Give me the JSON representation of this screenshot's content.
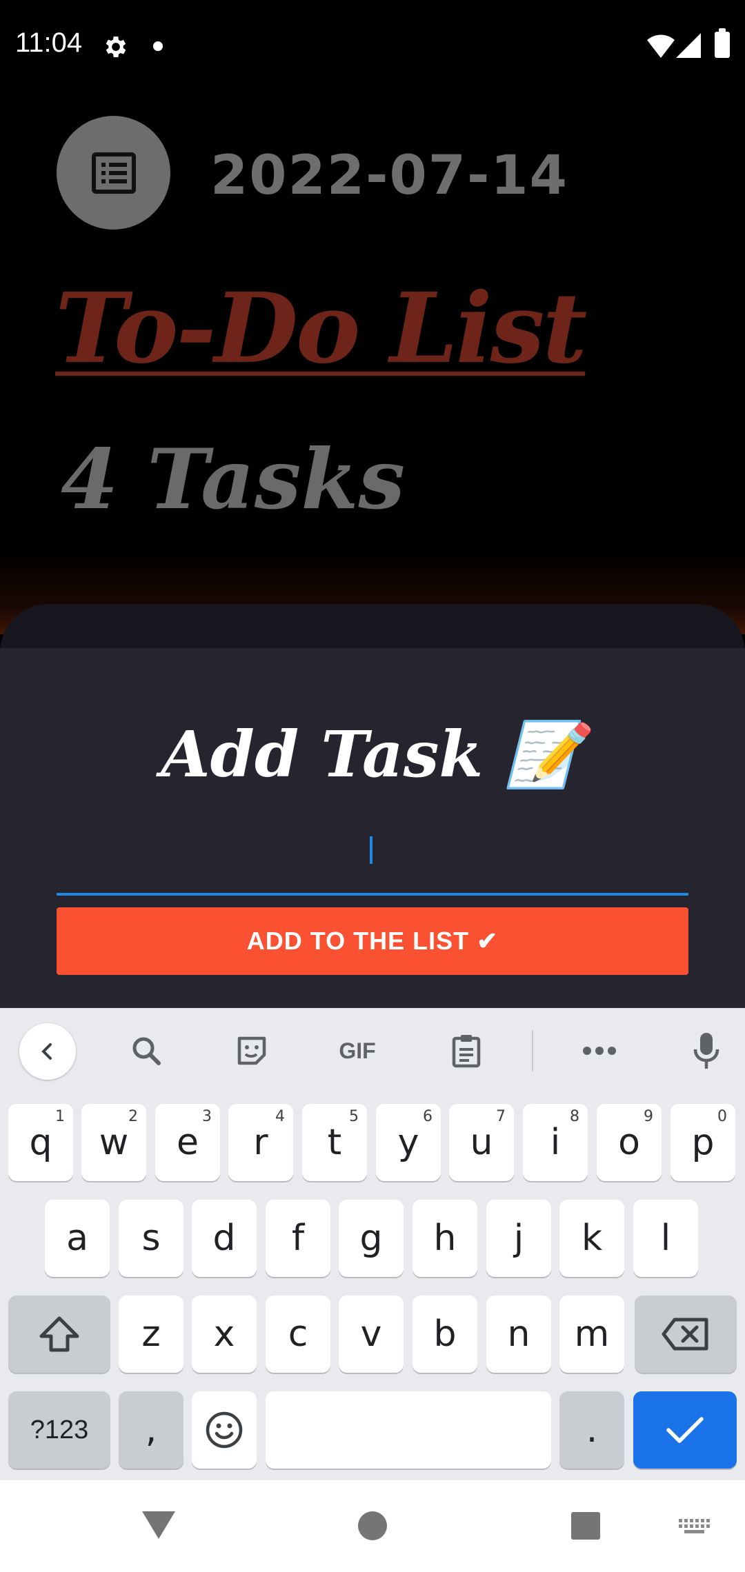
{
  "status_bar": {
    "time": "11:04",
    "icons": [
      "gear-icon",
      "notification-dot-icon",
      "wifi-icon",
      "signal-icon",
      "battery-icon"
    ]
  },
  "header": {
    "date": "2022-07-14",
    "title": "To-Do List",
    "task_count": "4 Tasks",
    "icon": "list-icon"
  },
  "sheet": {
    "title": "Add Task 📝",
    "input_value": "",
    "button_label": "ADD TO THE LIST ✔"
  },
  "keyboard": {
    "toolbar": {
      "gif_label": "GIF",
      "icons": [
        "back-chevron-icon",
        "search-icon",
        "sticker-icon",
        "gif-icon",
        "clipboard-icon",
        "more-icon",
        "mic-icon"
      ]
    },
    "row1": [
      {
        "k": "q",
        "h": "1"
      },
      {
        "k": "w",
        "h": "2"
      },
      {
        "k": "e",
        "h": "3"
      },
      {
        "k": "r",
        "h": "4"
      },
      {
        "k": "t",
        "h": "5"
      },
      {
        "k": "y",
        "h": "6"
      },
      {
        "k": "u",
        "h": "7"
      },
      {
        "k": "i",
        "h": "8"
      },
      {
        "k": "o",
        "h": "9"
      },
      {
        "k": "p",
        "h": "0"
      }
    ],
    "row2": [
      "a",
      "s",
      "d",
      "f",
      "g",
      "h",
      "j",
      "k",
      "l"
    ],
    "row3": [
      "z",
      "x",
      "c",
      "v",
      "b",
      "n",
      "m"
    ],
    "row4": {
      "symbols": "?123",
      "comma": ",",
      "period": "."
    }
  },
  "colors": {
    "accent": "#fb5133",
    "title": "#6e2418",
    "input_underline": "#1e88e5",
    "enter_key": "#1a73e8"
  }
}
